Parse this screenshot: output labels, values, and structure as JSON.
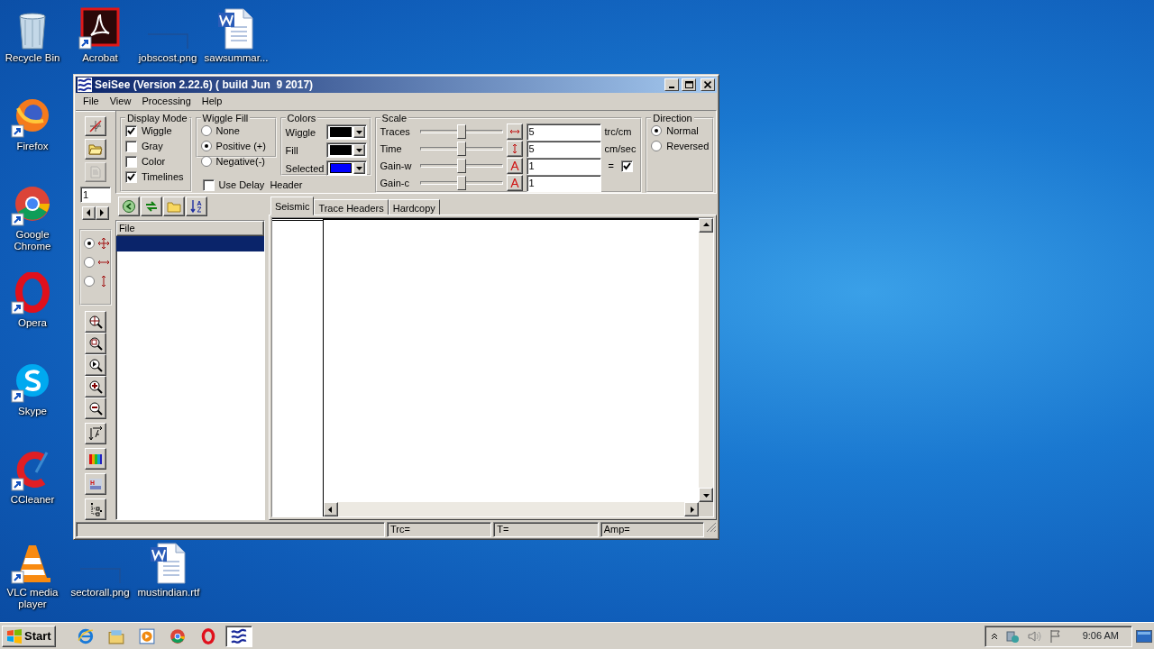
{
  "desktop_icons": [
    {
      "label": "Recycle Bin",
      "kind": "recycle-bin",
      "shortcut": false
    },
    {
      "label": "Acrobat",
      "kind": "pdf",
      "shortcut": true
    },
    {
      "label": "jobscost.png",
      "kind": "image",
      "shortcut": false
    },
    {
      "label": "sawsummar...",
      "kind": "word",
      "shortcut": false
    },
    {
      "label": "Firefox",
      "kind": "firefox",
      "shortcut": true
    },
    {
      "label": "Google Chrome",
      "kind": "chrome",
      "shortcut": true
    },
    {
      "label": "Opera",
      "kind": "opera",
      "shortcut": true
    },
    {
      "label": "Skype",
      "kind": "skype",
      "shortcut": true
    },
    {
      "label": "CCleaner",
      "kind": "ccleaner",
      "shortcut": true
    },
    {
      "label": "VLC media player",
      "kind": "vlc",
      "shortcut": true
    },
    {
      "label": "sectorall.png",
      "kind": "image",
      "shortcut": false
    },
    {
      "label": "mustindian.rtf",
      "kind": "word",
      "shortcut": false
    }
  ],
  "window": {
    "title": "SeiSee (Version 2.22.6) ( build Jun  9 2017)",
    "menu": [
      "File",
      "View",
      "Processing",
      "Help"
    ],
    "tools_top": [
      {
        "kind": "clear",
        "disabled": false
      },
      {
        "kind": "open",
        "disabled": false
      },
      {
        "kind": "save",
        "disabled": true
      }
    ],
    "page_field": {
      "value": "1"
    },
    "pan_modes": [
      {
        "kind": "both",
        "selected": true
      },
      {
        "kind": "horizontal",
        "selected": false
      },
      {
        "kind": "vertical",
        "selected": false
      }
    ],
    "tools_bottom": [
      {
        "kind": "zoom-all"
      },
      {
        "kind": "zoom-rect"
      },
      {
        "kind": "zoom-reset"
      },
      {
        "kind": "zoom-in"
      },
      {
        "kind": "zoom-out"
      },
      {
        "kind": "text-scale"
      },
      {
        "kind": "palette"
      },
      {
        "kind": "header"
      },
      {
        "kind": "tree"
      }
    ],
    "display_mode": {
      "title": "Display Mode",
      "options": [
        {
          "label": "Wiggle",
          "checked": true
        },
        {
          "label": "Gray",
          "checked": false
        },
        {
          "label": "Color",
          "checked": false
        },
        {
          "label": "Timelines",
          "checked": true
        }
      ]
    },
    "wiggle_fill": {
      "title": "Wiggle Fill",
      "options": [
        {
          "label": "None",
          "selected": false
        },
        {
          "label": "Positive (+)",
          "selected": true
        },
        {
          "label": "Negative(-)",
          "selected": false
        }
      ]
    },
    "use_delay_header": {
      "label": "Use Delay  Header",
      "checked": false
    },
    "colors": {
      "title": "Colors",
      "items": [
        {
          "label": "Wiggle",
          "color": "#000000"
        },
        {
          "label": "Fill",
          "color": "#000000"
        },
        {
          "label": "Selected",
          "color": "#0000ff"
        }
      ]
    },
    "scale": {
      "title": "Scale",
      "rows": [
        {
          "label": "Traces",
          "level": 0.5,
          "kind": "horizontal",
          "value": "5",
          "unit": "trc/cm"
        },
        {
          "label": "Time",
          "level": 0.5,
          "kind": "vertical",
          "value": "5",
          "unit": "cm/sec"
        },
        {
          "label": "Gain-w",
          "level": 0.5,
          "kind": "amplitude",
          "value": "1"
        },
        {
          "label": "Gain-c",
          "level": 0.5,
          "kind": "amplitude",
          "value": "1"
        }
      ],
      "link": {
        "label": "=",
        "checked": true
      }
    },
    "direction": {
      "title": "Direction",
      "options": [
        {
          "label": "Normal",
          "selected": true
        },
        {
          "label": "Reversed",
          "selected": false
        }
      ]
    },
    "file_tools": [
      {
        "kind": "add"
      },
      {
        "kind": "refresh"
      },
      {
        "kind": "folder"
      },
      {
        "kind": "sort"
      }
    ],
    "file_list": {
      "column": "File",
      "rows": [
        {
          "selected": true
        }
      ]
    },
    "tabs": [
      {
        "label": "Seismic",
        "selected": true
      },
      {
        "label": "Trace Headers",
        "selected": false
      },
      {
        "label": "Hardcopy",
        "selected": false
      }
    ],
    "status_bar": [
      "Trc=",
      "T=",
      "Amp="
    ]
  },
  "taskbar": {
    "start": "Start",
    "apps": [
      {
        "kind": "ie",
        "active": false
      },
      {
        "kind": "explorer",
        "active": false
      },
      {
        "kind": "media",
        "active": false
      },
      {
        "kind": "chrome",
        "active": false
      },
      {
        "kind": "opera",
        "active": false
      },
      {
        "kind": "seisee",
        "active": true
      }
    ],
    "clock": "9:06 AM"
  }
}
